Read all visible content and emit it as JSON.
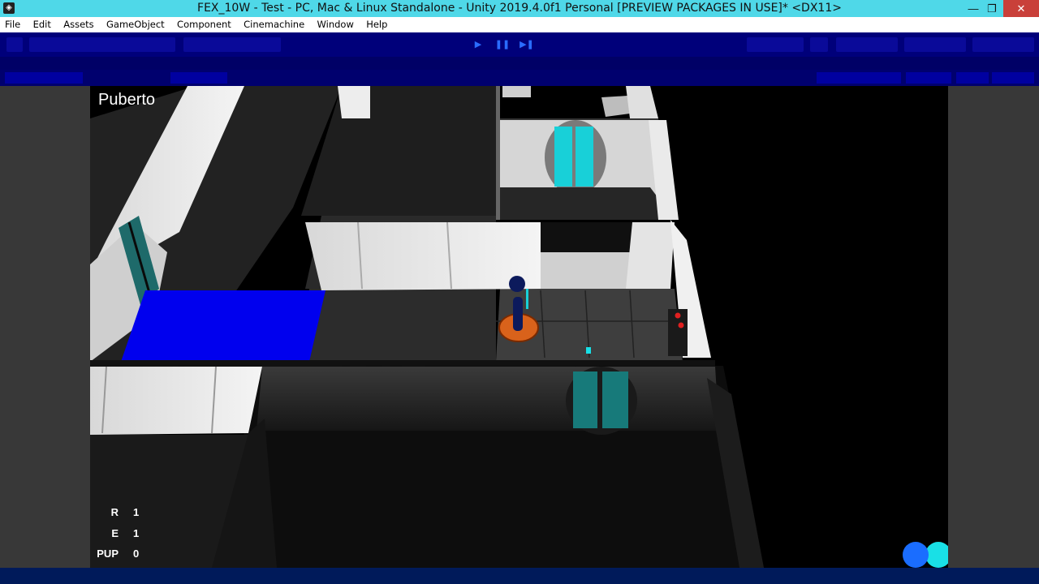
{
  "window": {
    "title": "FEX_10W - Test - PC, Mac & Linux Standalone - Unity 2019.4.0f1 Personal [PREVIEW PACKAGES IN USE]* <DX11>",
    "minimize_icon": "minimize-icon",
    "restore_icon": "restore-icon",
    "close_icon": "close-icon"
  },
  "menu": {
    "items": [
      "File",
      "Edit",
      "Assets",
      "GameObject",
      "Component",
      "Cinemachine",
      "Window",
      "Help"
    ]
  },
  "toolbar": {
    "play_icon": "play-icon",
    "pause_icon": "pause-icon",
    "step_icon": "step-icon"
  },
  "hud": {
    "player_name": "Puberto",
    "stats": [
      {
        "key": "R",
        "value": "1"
      },
      {
        "key": "E",
        "value": "1"
      },
      {
        "key": "PUP",
        "value": "0"
      }
    ]
  },
  "colors": {
    "titlebar": "#4fd8e8",
    "toolbar": "#00007a",
    "floor_blue": "#0000ee",
    "door_cyan": "#18d0d8",
    "circle_blue": "#1a6dff",
    "circle_cyan": "#19e0e6",
    "player_pad": "#d9621b"
  }
}
